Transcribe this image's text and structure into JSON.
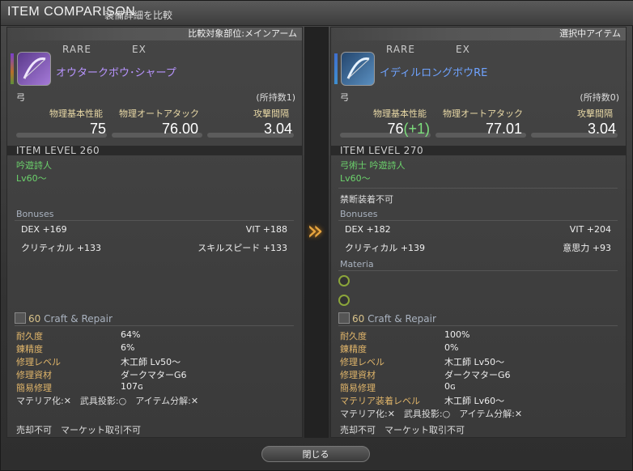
{
  "window": {
    "title_en": "ITEM COMPARISON",
    "title_jp": "装備詳細を比較"
  },
  "colors": {
    "rare_purple": "#b894ff",
    "rare_blue": "#6fa3ff",
    "green_text": "#6cd36c",
    "gold_label": "#e0b56a",
    "arrow": "#e8a640"
  },
  "left": {
    "header": "比較対象部位:メインアーム",
    "tag1": "RARE",
    "tag2": "EX",
    "icon": "bow-icon",
    "name": "オウタークボウ･シャープ",
    "type": "弓",
    "owned": "(所持数1)",
    "stats": {
      "l1": "物理基本性能",
      "l2": "物理オートアタック",
      "l3": "攻撃間隔",
      "v1": "75",
      "v2": "76.00",
      "v3": "3.04"
    },
    "ilvl": "ITEM LEVEL 260",
    "job": "吟遊詩人",
    "lv": "Lv60〜",
    "bonuses_title": "Bonuses",
    "b1": "DEX +169",
    "b2": "VIT +188",
    "b3": "クリティカル +133",
    "b4": "スキルスピード +133",
    "craft_num": "60",
    "craft_title": "Craft & Repair",
    "cr": [
      {
        "label": "耐久度",
        "value": "64%"
      },
      {
        "label": "錬精度",
        "value": "6%"
      },
      {
        "label": "修理レベル",
        "value": "木工師 Lv50〜"
      },
      {
        "label": "修理資材",
        "value": "ダークマターG6"
      },
      {
        "label": "簡易修理",
        "value": "107ɢ"
      }
    ],
    "flags": "マテリア化:✕　武具投影:○　アイテム分解:✕",
    "sale": "売却不可　マーケット取引不可"
  },
  "right": {
    "header": "選択中アイテム",
    "tag1": "RARE",
    "tag2": "EX",
    "icon": "bow-icon",
    "name": "イディルロングボウRE",
    "type": "弓",
    "owned": "(所持数0)",
    "stats": {
      "l1": "物理基本性能",
      "l2": "物理オートアタック",
      "l3": "攻撃間隔",
      "v1": "76",
      "v1plus": "(+1)",
      "v2": "77.01",
      "v3": "3.04"
    },
    "ilvl": "ITEM LEVEL 270",
    "job": "弓術士 吟遊詩人",
    "lv": "Lv60〜",
    "restrict": "禁断装着不可",
    "bonuses_title": "Bonuses",
    "b1": "DEX +182",
    "b2": "VIT +204",
    "b3": "クリティカル +139",
    "b4": "意思力 +93",
    "materia_title": "Materia",
    "craft_num": "60",
    "craft_title": "Craft & Repair",
    "cr": [
      {
        "label": "耐久度",
        "value": "100%"
      },
      {
        "label": "錬精度",
        "value": "0%"
      },
      {
        "label": "修理レベル",
        "value": "木工師 Lv50〜"
      },
      {
        "label": "修理資材",
        "value": "ダークマターG6"
      },
      {
        "label": "簡易修理",
        "value": "0ɢ"
      },
      {
        "label": "マテリア装着レベル",
        "value": "木工師 Lv60〜"
      }
    ],
    "flags": "マテリア化:✕　武具投影:○　アイテム分解:✕",
    "sale": "売却不可　マーケット取引不可"
  },
  "close_label": "閉じる"
}
